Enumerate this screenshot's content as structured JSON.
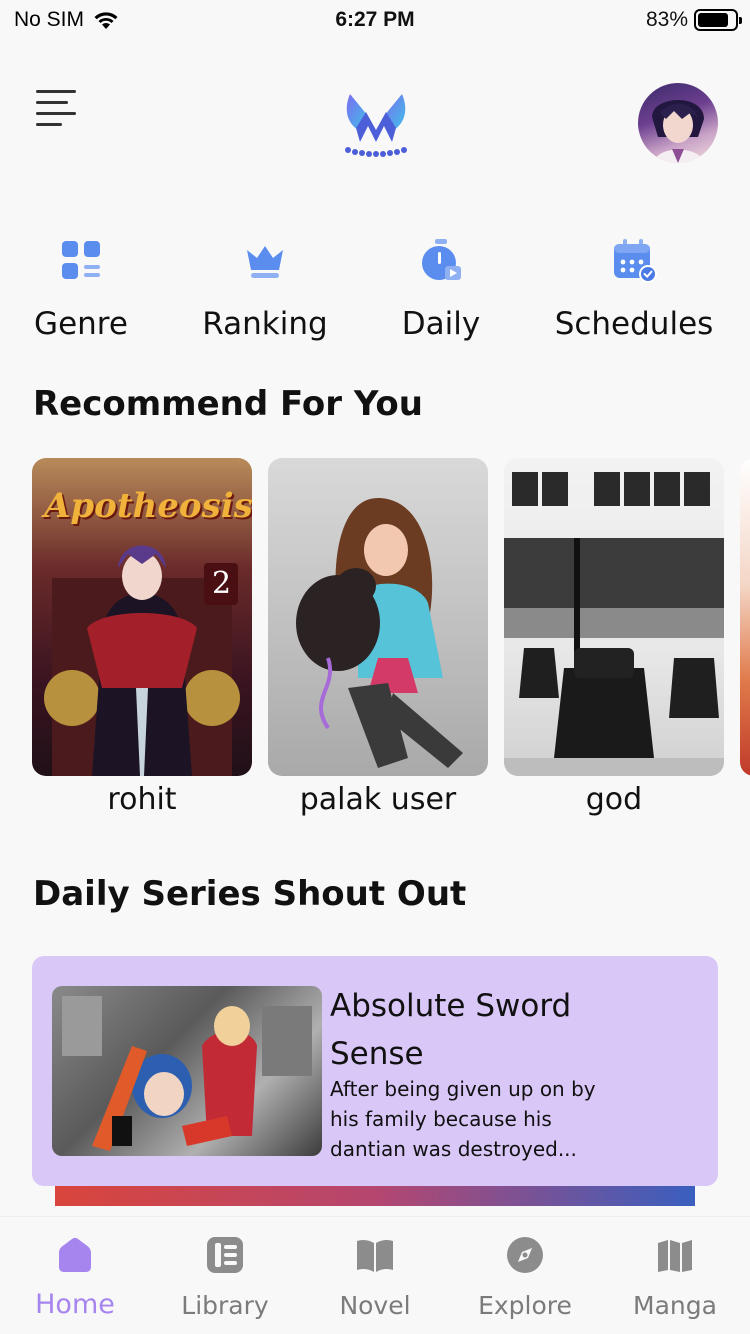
{
  "status_bar": {
    "carrier": "No SIM",
    "time": "6:27 PM",
    "battery": "83%",
    "battery_level": 0.83
  },
  "header": {
    "menu_icon": "menu-icon",
    "logo_icon": "app-logo-icon",
    "avatar_icon": "user-avatar"
  },
  "quick_nav": [
    {
      "label": "Genre",
      "icon": "genre-grid-icon"
    },
    {
      "label": "Ranking",
      "icon": "crown-icon"
    },
    {
      "label": "Daily",
      "icon": "timer-icon"
    },
    {
      "label": "Schedules",
      "icon": "calendar-icon"
    }
  ],
  "recommend": {
    "title": "Recommend For You",
    "items": [
      {
        "name": "rohit",
        "cover_text": "Apotheosis",
        "cover_badge": "2"
      },
      {
        "name": "palak user"
      },
      {
        "name": "god"
      }
    ]
  },
  "daily": {
    "title": "Daily Series Shout Out",
    "card": {
      "title": "Absolute Sword Sense",
      "description": "After being given up on by his family because his dantian was destroyed..."
    }
  },
  "tabs": [
    {
      "label": "Home",
      "icon": "home-icon",
      "active": true
    },
    {
      "label": "Library",
      "icon": "library-icon",
      "active": false
    },
    {
      "label": "Novel",
      "icon": "book-icon",
      "active": false
    },
    {
      "label": "Explore",
      "icon": "compass-icon",
      "active": false
    },
    {
      "label": "Manga",
      "icon": "manga-icon",
      "active": false
    }
  ],
  "colors": {
    "accent": "#a785ee",
    "icon_blue": "#5b8def",
    "card_bg": "#d9c7f8",
    "tab_inactive": "#7b7b7b"
  }
}
